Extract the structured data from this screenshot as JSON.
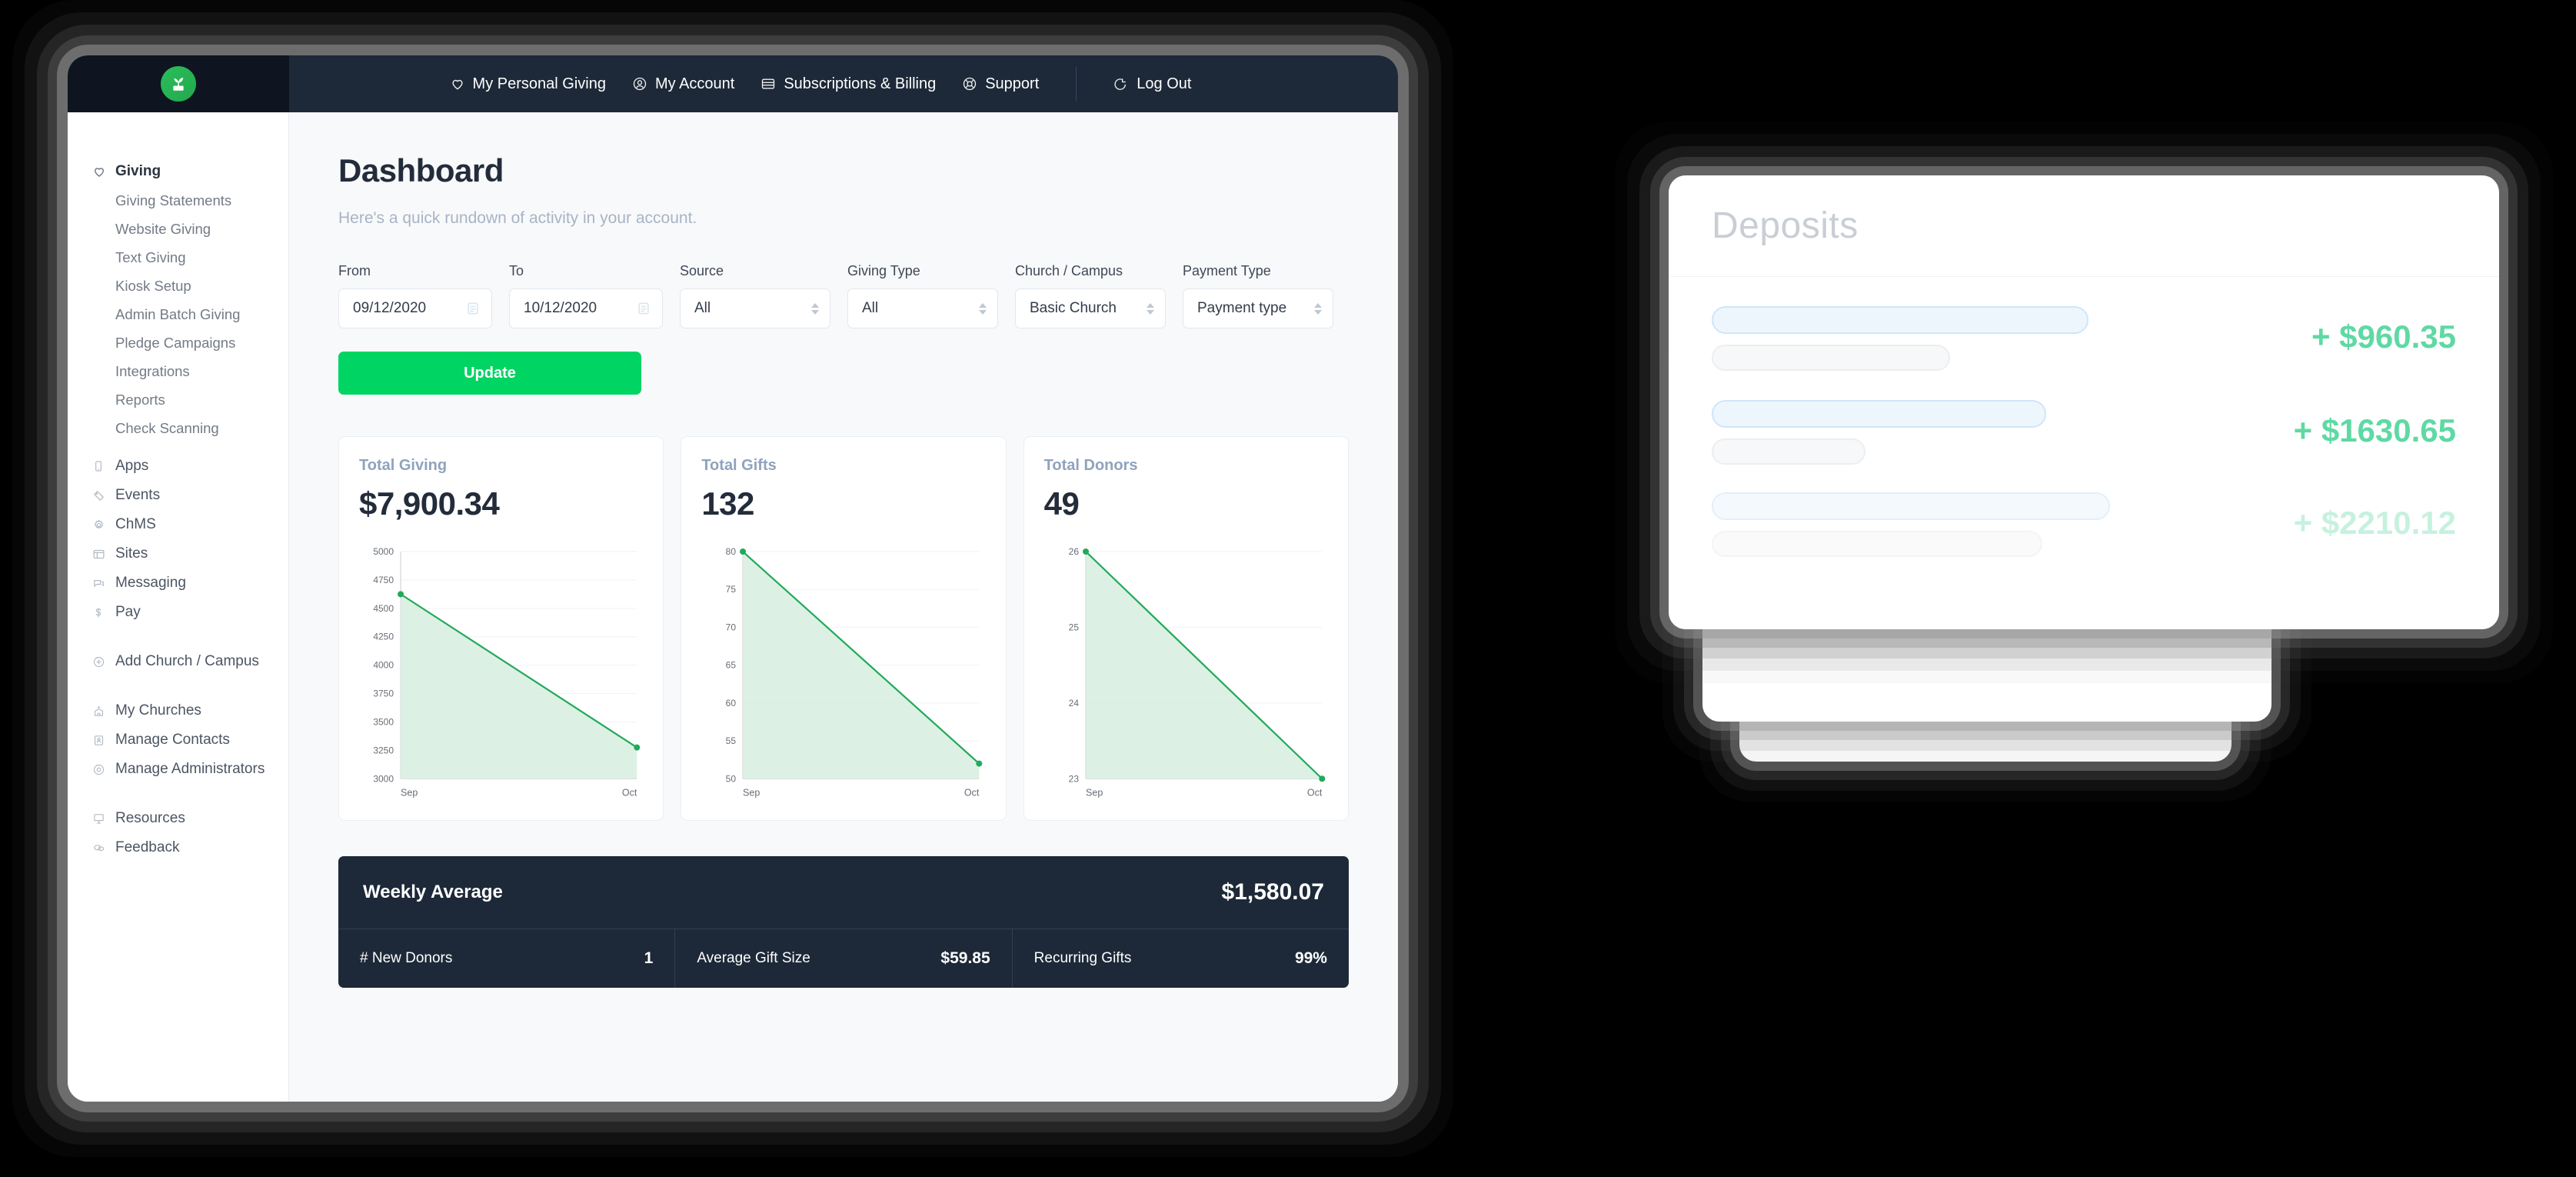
{
  "brand": {
    "logo_icon": "plant-sprout-icon",
    "accent_green": "#00d563",
    "dark_navy": "#1d2938",
    "logo_bg": "#0e1520"
  },
  "topnav": {
    "items": [
      {
        "label": "My Personal Giving",
        "icon": "heart-icon"
      },
      {
        "label": "My Account",
        "icon": "user-circle-icon"
      },
      {
        "label": "Subscriptions & Billing",
        "icon": "credit-card-icon"
      },
      {
        "label": "Support",
        "icon": "lifebuoy-icon"
      }
    ],
    "logout": {
      "label": "Log Out",
      "icon": "logout-arrow-icon"
    }
  },
  "sidebar": {
    "giving": {
      "label": "Giving",
      "icon": "heart-icon"
    },
    "giving_sub": [
      "Giving Statements",
      "Website Giving",
      "Text Giving",
      "Kiosk Setup",
      "Admin Batch Giving",
      "Pledge Campaigns",
      "Integrations",
      "Reports",
      "Check Scanning"
    ],
    "modules": [
      {
        "label": "Apps",
        "icon": "mobile-icon"
      },
      {
        "label": "Events",
        "icon": "ticket-icon"
      },
      {
        "label": "ChMS",
        "icon": "gear-icon"
      },
      {
        "label": "Sites",
        "icon": "browser-window-icon"
      },
      {
        "label": "Messaging",
        "icon": "chat-bubble-icon"
      },
      {
        "label": "Pay",
        "icon": "dollar-sign-icon"
      }
    ],
    "add": {
      "label": "Add Church / Campus",
      "icon": "plus-circle-icon"
    },
    "manage": [
      {
        "label": "My Churches",
        "icon": "church-building-icon"
      },
      {
        "label": "Manage Contacts",
        "icon": "contact-card-icon"
      },
      {
        "label": "Manage Administrators",
        "icon": "user-badge-icon"
      }
    ],
    "footer": [
      {
        "label": "Resources",
        "icon": "presentation-icon"
      },
      {
        "label": "Feedback",
        "icon": "speech-bubbles-icon"
      }
    ]
  },
  "page": {
    "title": "Dashboard",
    "subtitle": "Here's a quick rundown of activity in your account."
  },
  "filters": {
    "from": {
      "label": "From",
      "value": "09/12/2020",
      "icon": "calendar-icon"
    },
    "to": {
      "label": "To",
      "value": "10/12/2020",
      "icon": "calendar-icon"
    },
    "source": {
      "label": "Source",
      "value": "All"
    },
    "giving_type": {
      "label": "Giving Type",
      "value": "All"
    },
    "church_campus": {
      "label": "Church / Campus",
      "value": "Basic Church"
    },
    "payment_type": {
      "label": "Payment Type",
      "value": "Payment type"
    },
    "update_button": "Update"
  },
  "chart_data": [
    {
      "type": "area",
      "title": "Total Giving",
      "value_label": "$7,900.34",
      "x": [
        "Sep",
        "Oct"
      ],
      "values": [
        4625,
        3275
      ],
      "ylim": [
        3000,
        5000
      ],
      "yticks": [
        3000,
        3250,
        3500,
        3750,
        4000,
        4250,
        4500,
        4750,
        5000
      ],
      "xlabel": "",
      "ylabel": "",
      "grid": true,
      "legend": "none",
      "line_color": "#22a95b",
      "fill_color": "#d6eede"
    },
    {
      "type": "area",
      "title": "Total Gifts",
      "value_label": "132",
      "x": [
        "Sep",
        "Oct"
      ],
      "values": [
        80,
        52
      ],
      "ylim": [
        50,
        80
      ],
      "yticks": [
        50,
        55,
        60,
        65,
        70,
        75,
        80
      ],
      "xlabel": "",
      "ylabel": "",
      "grid": true,
      "legend": "none",
      "line_color": "#22a95b",
      "fill_color": "#d6eede"
    },
    {
      "type": "area",
      "title": "Total Donors",
      "value_label": "49",
      "x": [
        "Sep",
        "Oct"
      ],
      "values": [
        26,
        23
      ],
      "ylim": [
        23,
        26
      ],
      "yticks": [
        23,
        24,
        25,
        26
      ],
      "xlabel": "",
      "ylabel": "",
      "grid": true,
      "legend": "none",
      "line_color": "#22a95b",
      "fill_color": "#d6eede"
    }
  ],
  "weekly_average": {
    "label": "Weekly Average",
    "amount": "$1,580.07",
    "stats": [
      {
        "key": "# New Donors",
        "value": "1"
      },
      {
        "key": "Average Gift Size",
        "value": "$59.85"
      },
      {
        "key": "Recurring Gifts",
        "value": "99%"
      }
    ]
  },
  "deposits": {
    "title": "Deposits",
    "rows": [
      {
        "amount": "+ $960.35"
      },
      {
        "amount": "+ $1630.65"
      },
      {
        "amount": "+ $2210.12"
      }
    ]
  }
}
